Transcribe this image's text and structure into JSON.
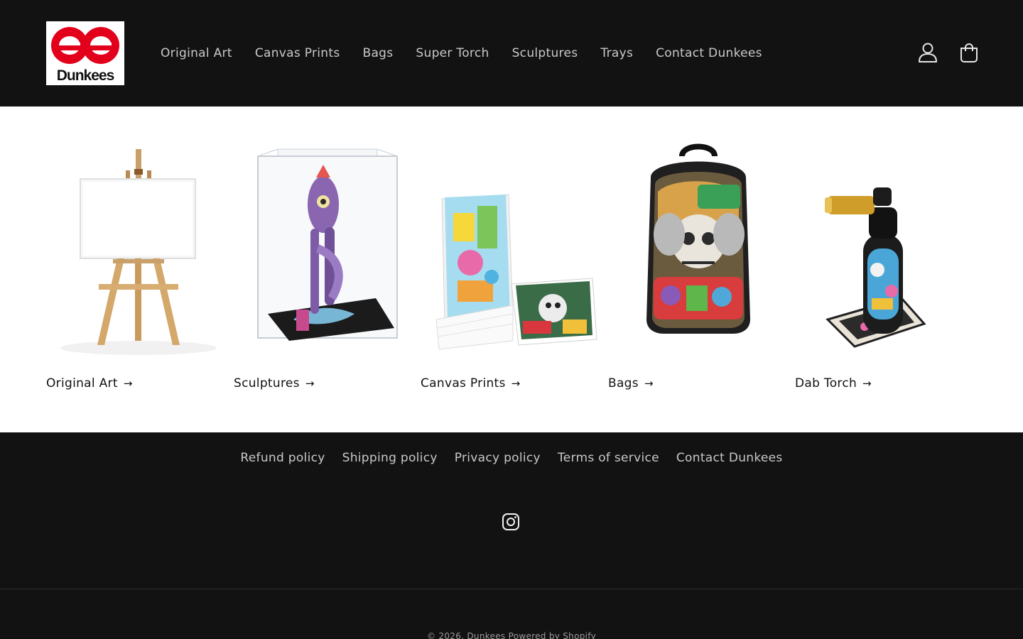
{
  "header": {
    "logo_text": "Dunkees",
    "nav": [
      {
        "label": "Original Art"
      },
      {
        "label": "Canvas Prints"
      },
      {
        "label": "Bags"
      },
      {
        "label": "Super Torch"
      },
      {
        "label": "Sculptures"
      },
      {
        "label": "Trays"
      },
      {
        "label": "Contact Dunkees"
      }
    ],
    "icons": [
      "account-icon",
      "cart-icon"
    ]
  },
  "collections": [
    {
      "title": "Original Art",
      "image": "easel-canvas"
    },
    {
      "title": "Sculptures",
      "image": "acrylic-case-sculpture"
    },
    {
      "title": "Canvas Prints",
      "image": "canvas-prints-stack"
    },
    {
      "title": "Bags",
      "image": "graffiti-backpack"
    },
    {
      "title": "Dab Torch",
      "image": "decorated-torch"
    }
  ],
  "footer": {
    "policies": [
      {
        "label": "Refund policy"
      },
      {
        "label": "Shipping policy"
      },
      {
        "label": "Privacy policy"
      },
      {
        "label": "Terms of service"
      },
      {
        "label": "Contact Dunkees"
      }
    ],
    "social": [
      "instagram-icon"
    ],
    "copyright": "© 2026, Dunkees Powered by Shopify"
  },
  "colors": {
    "header_bg": "#121212",
    "nav_text": "#c9c9c9",
    "body_bg": "#ffffff",
    "logo_red": "#e3001b"
  }
}
